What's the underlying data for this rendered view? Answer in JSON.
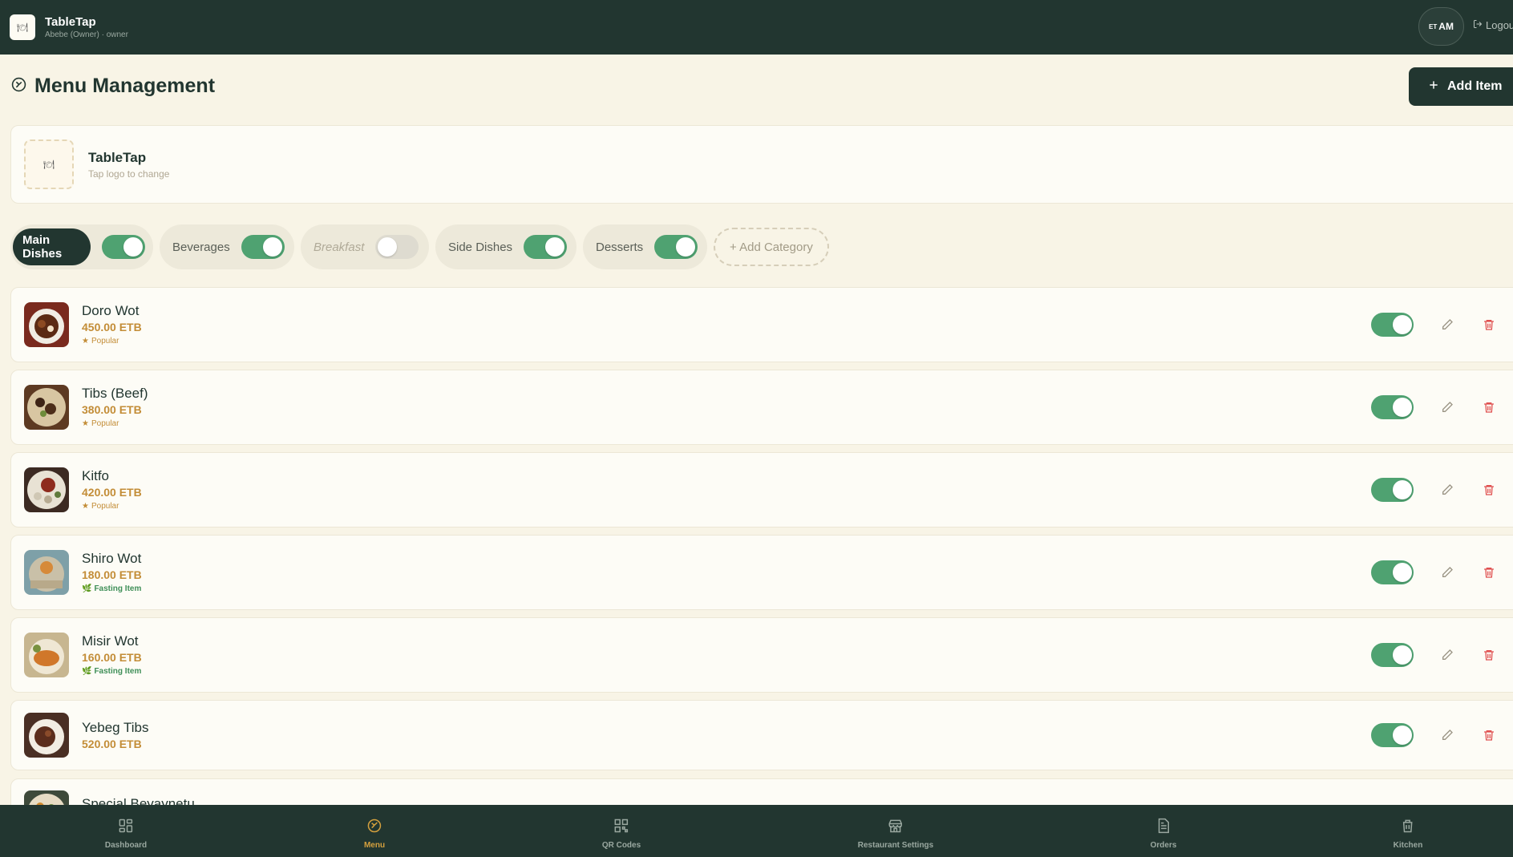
{
  "header": {
    "logo_glyph": "🍽",
    "app_name": "TableTap",
    "user_line": "Abebe (Owner) · owner",
    "lang_prefix": "ET",
    "lang_code": "AM",
    "logout_label": "Logout"
  },
  "page": {
    "title": "Menu Management",
    "add_item_label": "Add Item"
  },
  "restaurant": {
    "logo_glyph": "🍽",
    "name": "TableTap",
    "hint": "Tap logo to change"
  },
  "categories": [
    {
      "label": "Main Dishes",
      "enabled": true,
      "active": true
    },
    {
      "label": "Beverages",
      "enabled": true,
      "active": false
    },
    {
      "label": "Breakfast",
      "enabled": false,
      "active": false
    },
    {
      "label": "Side Dishes",
      "enabled": true,
      "active": false
    },
    {
      "label": "Desserts",
      "enabled": true,
      "active": false
    }
  ],
  "add_category_label": "+ Add Category",
  "items": [
    {
      "name": "Doro Wot",
      "price": "450.00 ETB",
      "tag": "Popular",
      "tag_type": "popular",
      "available": true
    },
    {
      "name": "Tibs (Beef)",
      "price": "380.00 ETB",
      "tag": "Popular",
      "tag_type": "popular",
      "available": true
    },
    {
      "name": "Kitfo",
      "price": "420.00 ETB",
      "tag": "Popular",
      "tag_type": "popular",
      "available": true
    },
    {
      "name": "Shiro Wot",
      "price": "180.00 ETB",
      "tag": "Fasting Item",
      "tag_type": "fasting",
      "available": true
    },
    {
      "name": "Misir Wot",
      "price": "160.00 ETB",
      "tag": "Fasting Item",
      "tag_type": "fasting",
      "available": true
    },
    {
      "name": "Yebeg Tibs",
      "price": "520.00 ETB",
      "tag": "",
      "tag_type": "",
      "available": true
    },
    {
      "name": "Special Beyaynetu",
      "price": "",
      "tag": "",
      "tag_type": "",
      "available": true
    }
  ],
  "nav": [
    {
      "label": "Dashboard",
      "icon": "dashboard-icon",
      "active": false
    },
    {
      "label": "Menu",
      "icon": "menu-icon",
      "active": true
    },
    {
      "label": "QR Codes",
      "icon": "qr-code-icon",
      "active": false
    },
    {
      "label": "Restaurant Settings",
      "icon": "store-icon",
      "active": false
    },
    {
      "label": "Orders",
      "icon": "orders-icon",
      "active": false
    },
    {
      "label": "Kitchen",
      "icon": "kitchen-icon",
      "active": false
    }
  ],
  "colors": {
    "header_bg": "#223630",
    "page_bg": "#f8f4e6",
    "accent_green": "#4fa271",
    "price_gold": "#c38d37",
    "active_nav": "#d4a03e",
    "delete_red": "#e0504f"
  }
}
